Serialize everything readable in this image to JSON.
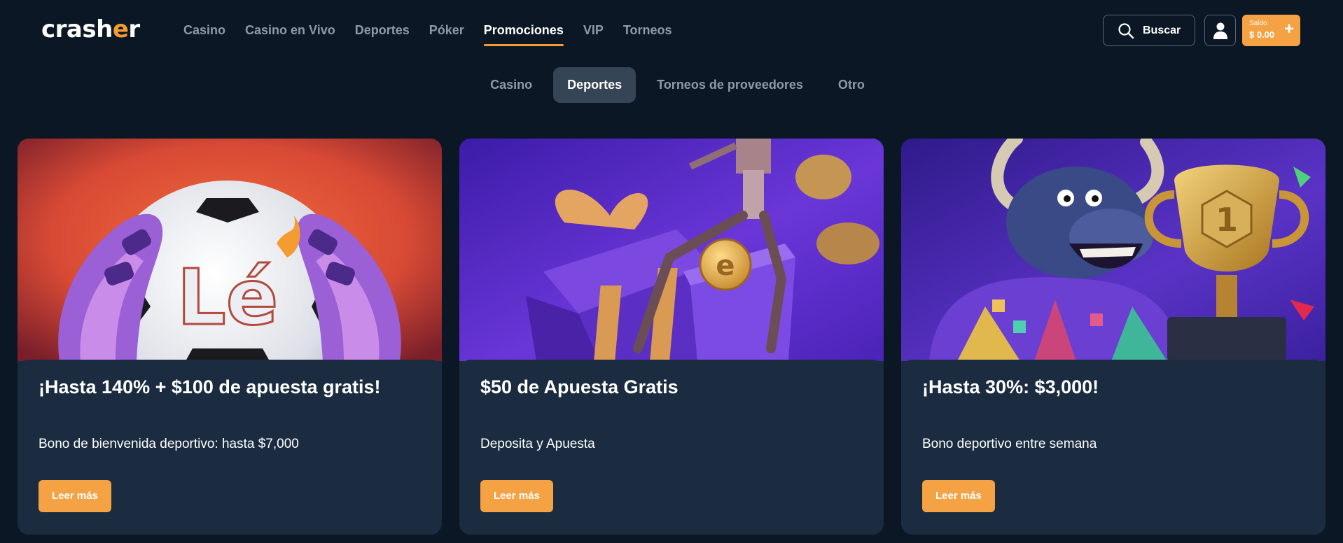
{
  "brand": {
    "logo_text_before": "crash",
    "logo_text_flame": "e",
    "logo_text_after": "r",
    "accent": "#f39c32"
  },
  "nav": {
    "items": [
      {
        "label": "Casino"
      },
      {
        "label": "Casino en Vivo"
      },
      {
        "label": "Deportes"
      },
      {
        "label": "Póker"
      },
      {
        "label": "Promociones",
        "active": true
      },
      {
        "label": "VIP"
      },
      {
        "label": "Torneos"
      }
    ]
  },
  "header": {
    "search_label": "Buscar",
    "search_icon": "search-icon",
    "user_icon": "user-icon",
    "balance_label": "Saldo",
    "balance_value": "$ 0.00",
    "balance_plus": "+"
  },
  "subtabs": [
    {
      "label": "Casino"
    },
    {
      "label": "Deportes",
      "active": true
    },
    {
      "label": "Torneos de proveedores"
    },
    {
      "label": "Otro"
    }
  ],
  "promos": [
    {
      "title": "¡Hasta 140% + $100 de apuesta gratis!",
      "description": "Bono de bienvenida deportivo: hasta $7,000",
      "button": "Leer más",
      "image": "soccer-ball-goalkeeper-gloves",
      "image_text": "Lé"
    },
    {
      "title": "$50 de Apuesta Gratis",
      "description": "Deposita y Apuesta",
      "button": "Leer más",
      "image": "claw-machine-gift-box-coins"
    },
    {
      "title": "¡Hasta 30%: $3,000!",
      "description": "Bono deportivo entre semana",
      "button": "Leer más",
      "image": "bull-with-trophy",
      "image_text": "1"
    }
  ]
}
